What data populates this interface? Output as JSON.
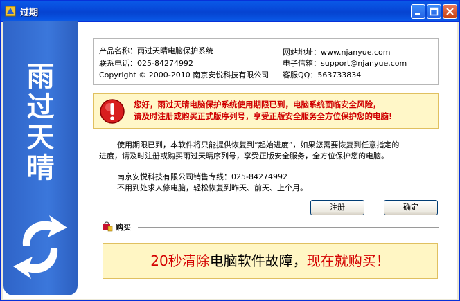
{
  "window": {
    "title": "过期"
  },
  "sidebar": {
    "title_chars": [
      "雨",
      "过",
      "天",
      "晴"
    ]
  },
  "info": {
    "product_name": "产品名称：雨过天晴电脑保护系统",
    "phone": "联系电话：025-84274992",
    "copyright": "Copyright © 2000-2010 南京安悦科技有限公司",
    "website": "网站地址：www.njanyue.com",
    "email": "电子信箱：support@njanyue.com",
    "qq": "客服QQ：563733834"
  },
  "warning": {
    "line1": "您好，雨过天晴电脑保护系统使用期限已到，电脑系统面临安全风险，",
    "line2": "请及时注册或购买正式版序列号，享受正版安全服务全方位保护您的电脑!"
  },
  "message": {
    "line1": "使用期限已到，本软件将只能提供恢复到“起始进度”，如果您需要恢复到任意指定的",
    "line2": "进度，请及时注册或购买雨过天晴序列号，享受正版安全服务，全方位保护您的电脑。",
    "sales_line": "南京安悦科技有限公司销售专线：025-84274992",
    "slogan_line": "不用到处求人修电脑，轻松恢复到昨天、前天、上个月。"
  },
  "buttons": {
    "register": "注册",
    "ok": "确定"
  },
  "purchase": {
    "section_label": "购买",
    "banner_part1": "20秒清除",
    "banner_part2": "电脑软件故障，",
    "banner_part3": "现在就购买！"
  },
  "colors": {
    "titlebar": "#0a5ae8",
    "sidebar": "#3b77db",
    "warning_text": "#d00000",
    "banner_bg": "#fff6c4"
  },
  "icons": {
    "title": "app-icon",
    "warning": "error-icon",
    "purchase": "shopping-icon",
    "logo": "arrows-logo-icon"
  }
}
